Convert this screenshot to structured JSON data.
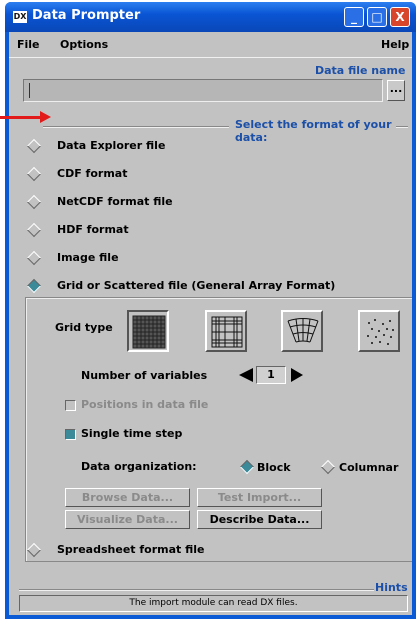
{
  "window": {
    "title": "Data Prompter",
    "icon_text": "DX",
    "min_label": "_",
    "max_label": "□",
    "close_label": "X"
  },
  "menu": {
    "file": "File",
    "options": "Options",
    "help": "Help"
  },
  "datafile": {
    "label": "Data file name",
    "value": "",
    "browse_label": "..."
  },
  "format": {
    "heading": "Select the format of your data:",
    "options": [
      {
        "label": "Data Explorer file",
        "selected": false
      },
      {
        "label": "CDF format",
        "selected": false
      },
      {
        "label": "NetCDF format file",
        "selected": false
      },
      {
        "label": "HDF format",
        "selected": false
      },
      {
        "label": "Image file",
        "selected": false
      },
      {
        "label": "Grid or Scattered file (General Array Format)",
        "selected": true
      },
      {
        "label": "Spreadsheet format file",
        "selected": false
      }
    ]
  },
  "gaf": {
    "grid_type_label": "Grid type",
    "grid_types": [
      "regular-grid-icon",
      "deformed-regular-grid-icon",
      "warped-grid-icon",
      "scattered-points-icon"
    ],
    "num_vars_label": "Number of variables",
    "num_vars": "1",
    "positions_label": "Positions in data file",
    "positions_checked": false,
    "single_timestep_label": "Single time step",
    "single_timestep_checked": true,
    "data_org_label": "Data organization:",
    "org_block": "Block",
    "org_columnar": "Columnar",
    "org_selected": "Block",
    "browse_data": "Browse Data...",
    "test_import": "Test Import...",
    "visualize_data": "Visualize Data...",
    "describe_data": "Describe Data..."
  },
  "hints": {
    "label": "Hints",
    "text": "The import module can read DX files."
  },
  "colors": {
    "title_blue": "#0a5ad6",
    "section_blue": "#1b4fa8",
    "panel_gray": "#c2c2c2",
    "selected_teal": "#3a8a9a",
    "annotation_red": "#e31a1a"
  }
}
